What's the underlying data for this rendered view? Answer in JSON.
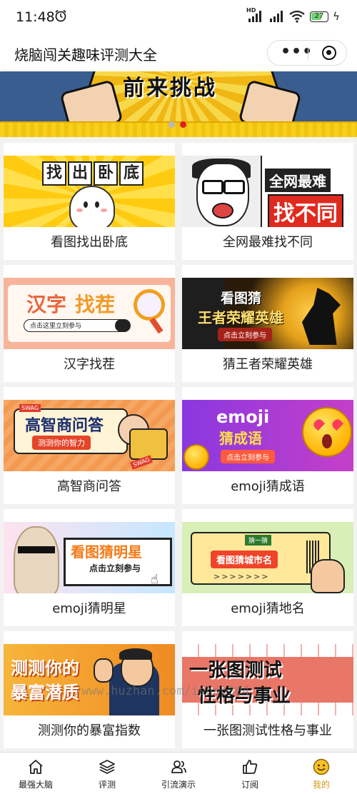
{
  "status_bar": {
    "time": "11:48",
    "battery": "27",
    "network_badge": "HD",
    "icons": [
      "alarm-icon",
      "signal-icon",
      "signal-icon",
      "wifi-icon",
      "battery-icon",
      "charging-icon"
    ]
  },
  "nav": {
    "title": "烧脑闯关趣味评测大全",
    "more_icon": "more-dots-icon",
    "close_icon": "target-icon"
  },
  "banner": {
    "slogan": "前来挑战",
    "active_index": 1,
    "dot_count": 2
  },
  "cards": [
    {
      "label": "看图找出卧底",
      "art": {
        "chars": [
          "找",
          "出",
          "卧",
          "底"
        ]
      }
    },
    {
      "label": "全网最难找不同",
      "art": {
        "line1": "全网最难",
        "line2": "找不同"
      }
    },
    {
      "label": "汉字找茬",
      "art": {
        "line1": "汉字",
        "line2": "找茬",
        "search": "点击这里立刻参与"
      }
    },
    {
      "label": "猜王者荣耀英雄",
      "art": {
        "line1": "看图猜",
        "line2": "王者荣耀英雄",
        "cta": "点击立刻参与"
      }
    },
    {
      "label": "高智商问答",
      "art": {
        "line1": "高智商问答",
        "cta": "测测你的智力",
        "tag": "SWAG"
      }
    },
    {
      "label": "emoji猜成语",
      "art": {
        "line1": "emoji",
        "line2": "猜成语",
        "cta": "点击立刻参与"
      }
    },
    {
      "label": "emoji猜明星",
      "art": {
        "line1": "看图猜明星",
        "cta": "点击立刻参与"
      }
    },
    {
      "label": "emoji猜地名",
      "art": {
        "tag": "猜一猜",
        "line1": "看图猜城市名",
        "arrows": ">>>>>>>"
      }
    },
    {
      "label": "测测你的暴富指数",
      "art": {
        "line1": "测测你的",
        "line2": "暴富潜质"
      }
    },
    {
      "label": "一张图测试性格与事业",
      "art": {
        "line1": "一张图测试",
        "line2": "性格与事业"
      }
    }
  ],
  "watermark": "/www.huzhan.com/ishop304",
  "tabbar": {
    "items": [
      {
        "label": "最强大脑",
        "icon": "home-icon"
      },
      {
        "label": "评测",
        "icon": "layers-icon"
      },
      {
        "label": "引流演示",
        "icon": "user-group-icon"
      },
      {
        "label": "订阅",
        "icon": "thumbs-up-icon"
      },
      {
        "label": "我的",
        "icon": "smiley-icon"
      }
    ],
    "active_index": 4,
    "active_color": "#d19a15"
  },
  "colors": {
    "banner_dot_active": "#e02020",
    "banner_yellow": "#f4c21a"
  }
}
